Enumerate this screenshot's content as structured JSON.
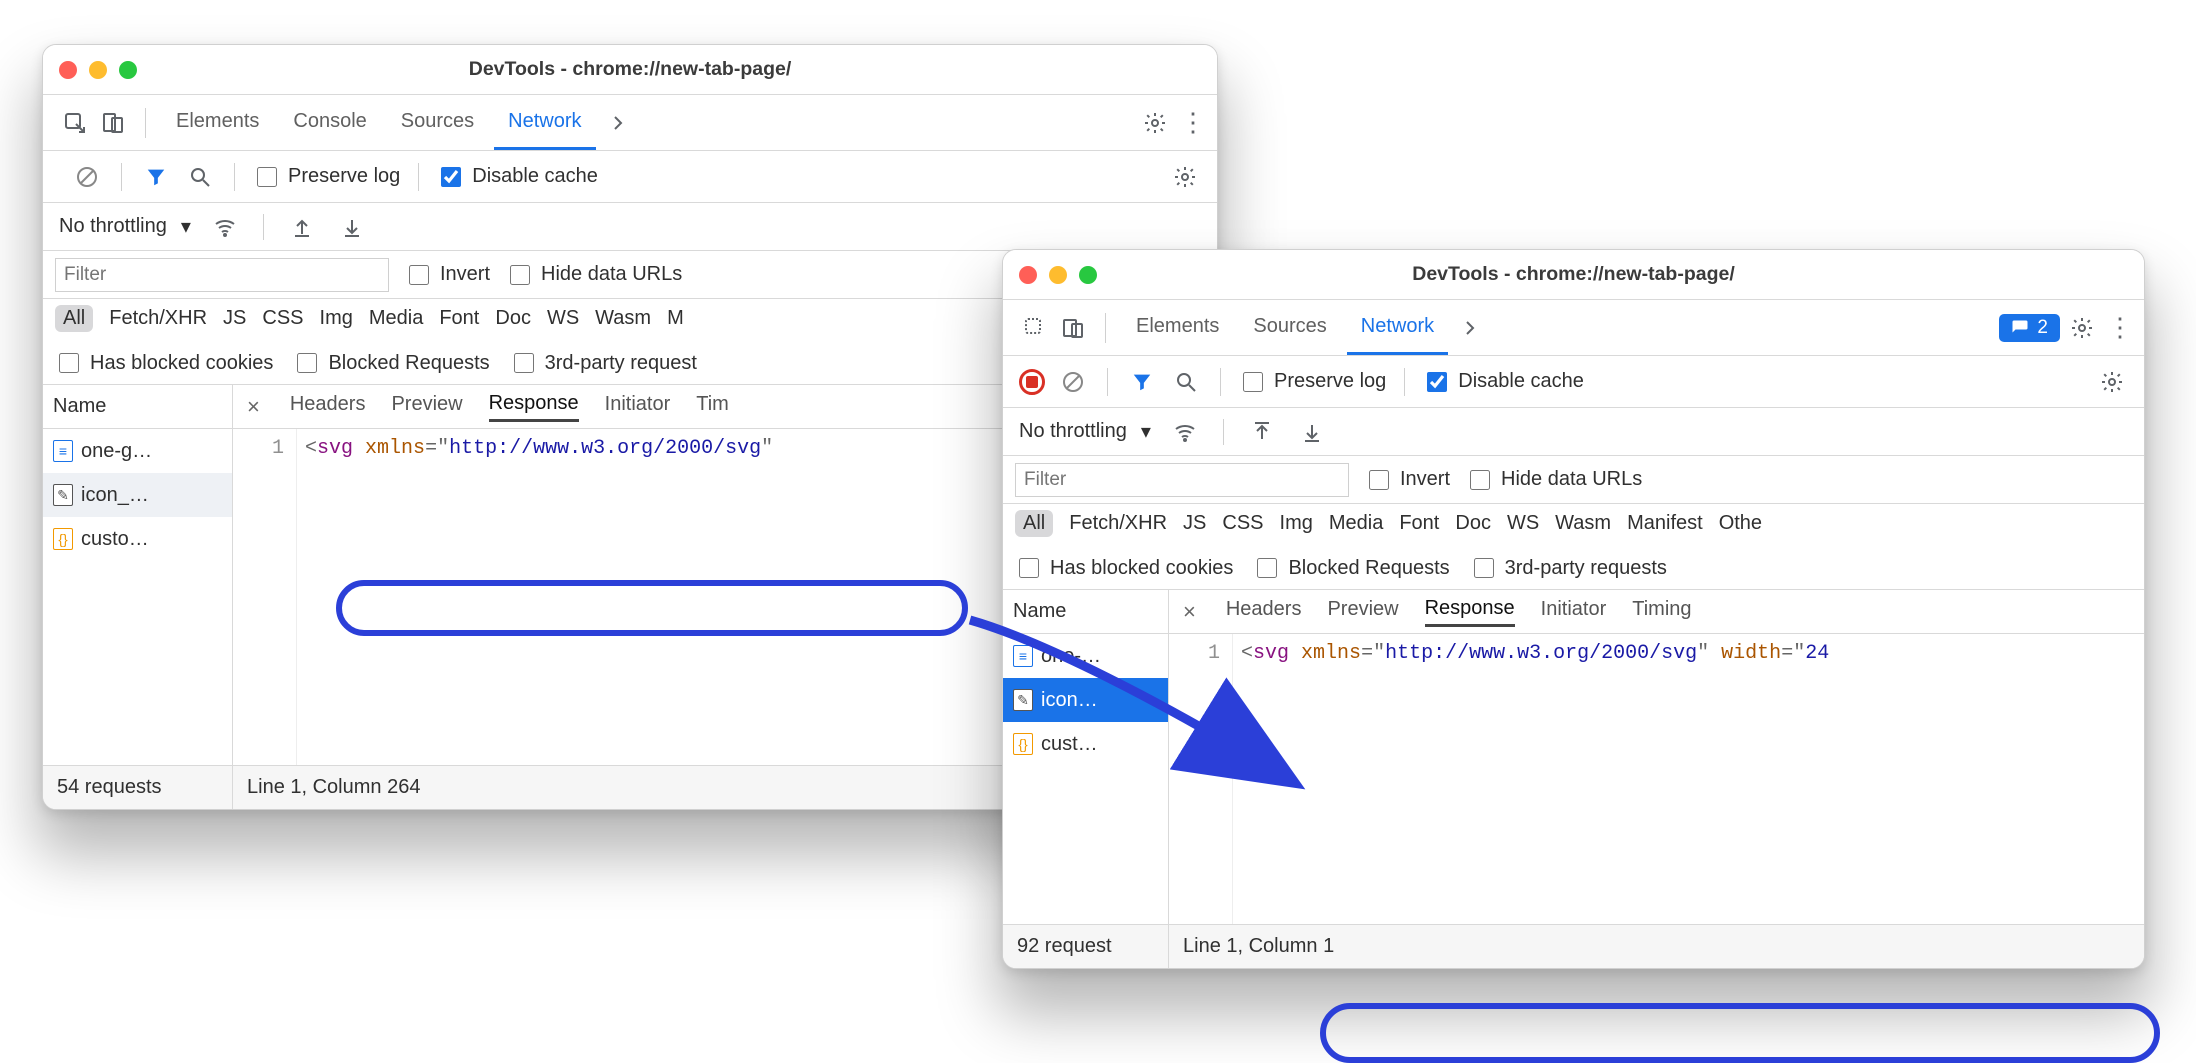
{
  "window1": {
    "title": "DevTools - chrome://new-tab-page/",
    "tabs": [
      {
        "label": "Elements",
        "active": false
      },
      {
        "label": "Console",
        "active": false
      },
      {
        "label": "Sources",
        "active": false
      },
      {
        "label": "Network",
        "active": true
      }
    ],
    "net_toolbar": {
      "preserve_log_label": "Preserve log",
      "disable_cache_label": "Disable cache",
      "disable_cache_checked": true
    },
    "throttling_label": "No throttling",
    "filter": {
      "placeholder": "Filter",
      "invert_label": "Invert",
      "hide_label": "Hide data URLs"
    },
    "types": [
      "All",
      "Fetch/XHR",
      "JS",
      "CSS",
      "Img",
      "Media",
      "Font",
      "Doc",
      "WS",
      "Wasm",
      "M"
    ],
    "type_active": "All",
    "extra_filters": {
      "blocked_cookies": "Has blocked cookies",
      "blocked_requests": "Blocked Requests",
      "third_party": "3rd-party request"
    },
    "name_header": "Name",
    "rows": [
      {
        "icon": "doc",
        "label": "one-g…"
      },
      {
        "icon": "pen",
        "label": "icon_…",
        "selected": true
      },
      {
        "icon": "code",
        "label": "custo…"
      }
    ],
    "detail_tabs": [
      "Headers",
      "Preview",
      "Response",
      "Initiator",
      "Tim"
    ],
    "detail_active": "Response",
    "line_number": "1",
    "code_plain": "<svg xmlns=\"http://www.w3.org/2000/svg\"",
    "status_left": "54 requests",
    "status_right": "Line 1, Column 264"
  },
  "window2": {
    "title": "DevTools - chrome://new-tab-page/",
    "tabs": [
      {
        "label": "Elements",
        "active": false
      },
      {
        "label": "Sources",
        "active": false
      },
      {
        "label": "Network",
        "active": true
      }
    ],
    "issues_count": "2",
    "net_toolbar": {
      "preserve_log_label": "Preserve log",
      "disable_cache_label": "Disable cache",
      "disable_cache_checked": true
    },
    "throttling_label": "No throttling",
    "filter": {
      "placeholder": "Filter",
      "invert_label": "Invert",
      "hide_label": "Hide data URLs"
    },
    "types": [
      "All",
      "Fetch/XHR",
      "JS",
      "CSS",
      "Img",
      "Media",
      "Font",
      "Doc",
      "WS",
      "Wasm",
      "Manifest",
      "Othe"
    ],
    "type_active": "All",
    "extra_filters": {
      "blocked_cookies": "Has blocked cookies",
      "blocked_requests": "Blocked Requests",
      "third_party": "3rd-party requests"
    },
    "name_header": "Name",
    "rows": [
      {
        "icon": "doc",
        "label": "one-…"
      },
      {
        "icon": "pen",
        "label": "icon…",
        "selected": true
      },
      {
        "icon": "code",
        "label": "cust…"
      }
    ],
    "detail_tabs": [
      "Headers",
      "Preview",
      "Response",
      "Initiator",
      "Timing"
    ],
    "detail_active": "Response",
    "line_number": "1",
    "code_plain": "<svg xmlns=\"http://www.w3.org/2000/svg\" width=\"24",
    "status_left": "92 request",
    "status_right": "Line 1, Column 1"
  }
}
